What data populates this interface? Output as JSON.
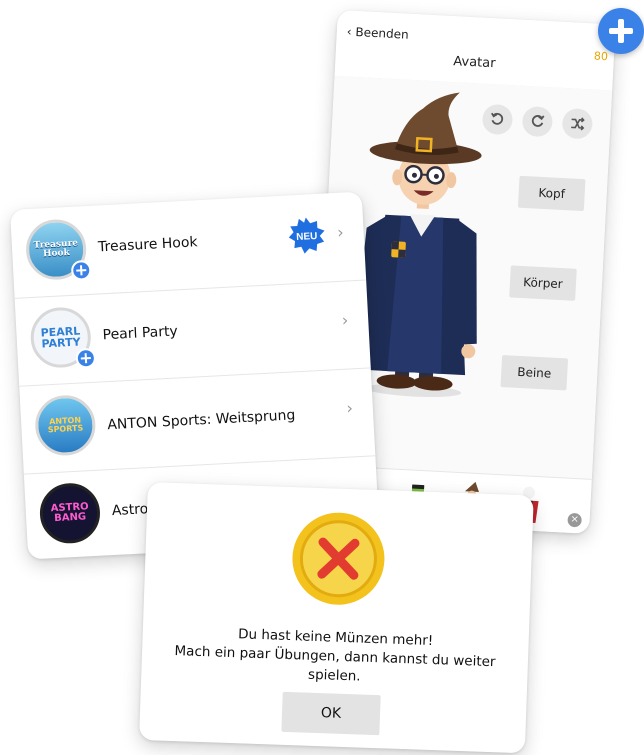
{
  "avatar_screen": {
    "back_label": "‹ Beenden",
    "coins": "80",
    "title": "Avatar",
    "categories": [
      "Kopf",
      "Körper",
      "Beine"
    ],
    "controls": [
      "undo-icon",
      "redo-icon",
      "shuffle-icon"
    ],
    "thumbnails": [
      "cat-costume-avatar",
      "frankenstein-avatar",
      "wizard-avatar",
      "vampire-avatar"
    ]
  },
  "games": [
    {
      "name": "Treasure Hook",
      "icon_text": "Treasure Hook",
      "badge": "NEU",
      "has_add": true
    },
    {
      "name": "Pearl Party",
      "icon_text": "PEARL PARTY",
      "has_add": true
    },
    {
      "name": "ANTON Sports: Weitsprung",
      "icon_text": "ANTON SPORTS",
      "has_add": false
    },
    {
      "name": "Astro",
      "icon_text": "ASTRO BANG",
      "has_add": false
    }
  ],
  "dialog": {
    "lines": [
      "Du hast keine Münzen mehr!",
      "Mach ein paar Übungen, dann kannst du weiter",
      "spielen."
    ],
    "ok_label": "OK"
  },
  "colors": {
    "accent": "#3b82e8",
    "coin": "#f3c21c",
    "error": "#e23b2f",
    "button_bg": "#e3e3e3"
  }
}
